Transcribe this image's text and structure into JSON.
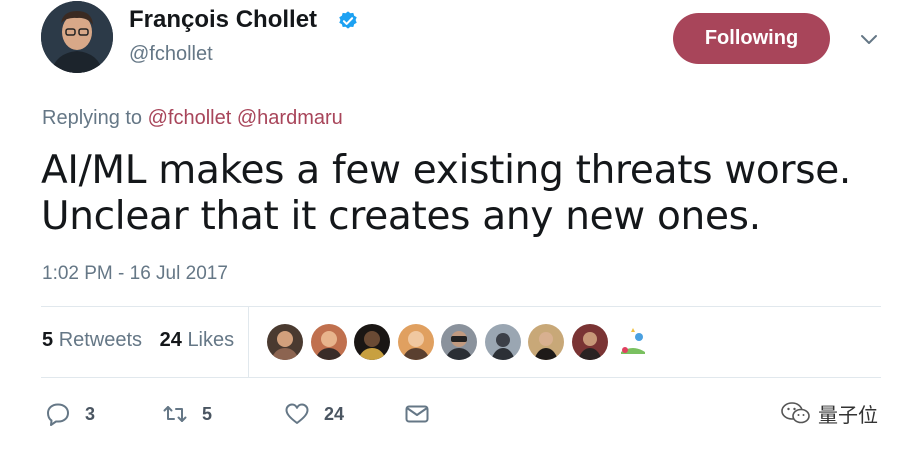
{
  "author": {
    "name": "François Chollet",
    "handle": "@fchollet",
    "verified": true
  },
  "follow_button": {
    "label": "Following",
    "color": "#a8455a"
  },
  "reply": {
    "prefix": "Replying to",
    "mentions": [
      "@fchollet",
      "@hardmaru"
    ]
  },
  "tweet": {
    "lines": [
      "AI/ML makes a few existing threats worse.",
      "Unclear that it creates any new ones."
    ]
  },
  "timestamp": "1:02 PM - 16 Jul 2017",
  "stats": {
    "retweets_count": "5",
    "retweets_label": "Retweets",
    "likes_count": "24",
    "likes_label": "Likes"
  },
  "likers": [
    {
      "icon": "avatar-1",
      "color": "#7a5a48"
    },
    {
      "icon": "avatar-2",
      "color": "#b0624a"
    },
    {
      "icon": "avatar-3",
      "color": "#2a2622"
    },
    {
      "icon": "avatar-4",
      "color": "#c7804c"
    },
    {
      "icon": "avatar-5",
      "color": "#59606a"
    },
    {
      "icon": "avatar-6",
      "color": "#6b7580"
    },
    {
      "icon": "avatar-7",
      "color": "#6e5a40"
    },
    {
      "icon": "avatar-8",
      "color": "#8a3c3c"
    },
    {
      "icon": "avatar-9-landscape",
      "color": "#ffffff"
    }
  ],
  "actions": {
    "reply_count": "3",
    "retweet_count": "5",
    "like_count": "24"
  },
  "watermark": {
    "text": "量子位"
  },
  "colors": {
    "accent": "#a8455a",
    "secondary_text": "#657786",
    "primary_text": "#14171a",
    "divider": "#e1e8ed",
    "verified": "#1da1f2"
  }
}
